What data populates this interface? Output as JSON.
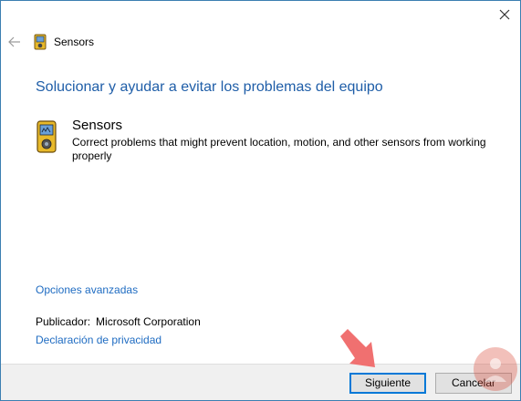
{
  "window": {
    "title": "Sensors",
    "back_icon": "back-arrow-icon",
    "close_icon": "close-icon",
    "app_icon": "sensor-device-icon"
  },
  "main": {
    "heading": "Solucionar y ayudar a evitar los problemas del equipo",
    "troubleshooter": {
      "icon": "sensor-device-icon",
      "title": "Sensors",
      "description": "Correct problems that might prevent location, motion, and other sensors from working properly"
    },
    "advanced_link": "Opciones avanzadas",
    "publisher_label": "Publicador:",
    "publisher_value": "Microsoft Corporation",
    "privacy_link": "Declaración de privacidad"
  },
  "footer": {
    "next_label": "Siguiente",
    "cancel_label": "Cancelar"
  },
  "overlays": {
    "arrow_icon": "pointer-arrow-icon",
    "arrow_color": "#f07070",
    "watermark_icon": "watermark-logo-icon"
  },
  "colors": {
    "heading": "#1f5ea8",
    "link": "#1f6cc2",
    "footer_bg": "#f0f0f0"
  }
}
